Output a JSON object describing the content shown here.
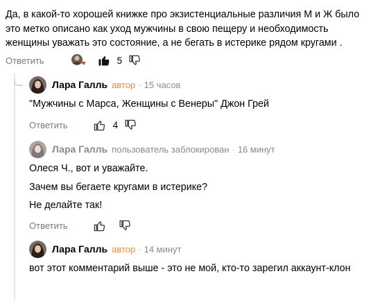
{
  "root": {
    "text": "Да, в какой-то хорошей книжке про экзистенциальные различия М и Ж было это метко описано как уход мужчины в свою пещеру и необходимость женщины уважать это состояние, а не бегать в истерике рядом кругами .",
    "reply_label": "Ответить",
    "like_count": "5"
  },
  "comments": [
    {
      "author": "Лара Галль",
      "badge": "автор",
      "time": "15 часов",
      "lines": [
        "\"Мужчины с Марса, Женщины с Венеры\" Джон Грей"
      ],
      "reply_label": "Ответить",
      "like_count": "4"
    },
    {
      "author": "Лара Галль",
      "badge": "пользователь заблокирован",
      "time": "16 минут",
      "lines": [
        "Олеся Ч., вот и уважайте.",
        "Зачем вы бегаете кругами в истерике?",
        "Не делайте так!"
      ],
      "reply_label": "Ответить"
    },
    {
      "author": "Лара Галль",
      "badge": "автор",
      "time": "14 минут",
      "lines": [
        "вот этот комментарий выше - это не мой, кто-то зарегил аккаунт-клон"
      ]
    }
  ],
  "separator": "·",
  "colors": {
    "badge_author": "#f08a2c",
    "muted": "#8a8a8a",
    "reply": "#7a7a7a",
    "heart": "#e8364b"
  },
  "icons": [
    "avatar-with-heart-icon",
    "thumbs-up-icon",
    "thumbs-down-icon"
  ]
}
